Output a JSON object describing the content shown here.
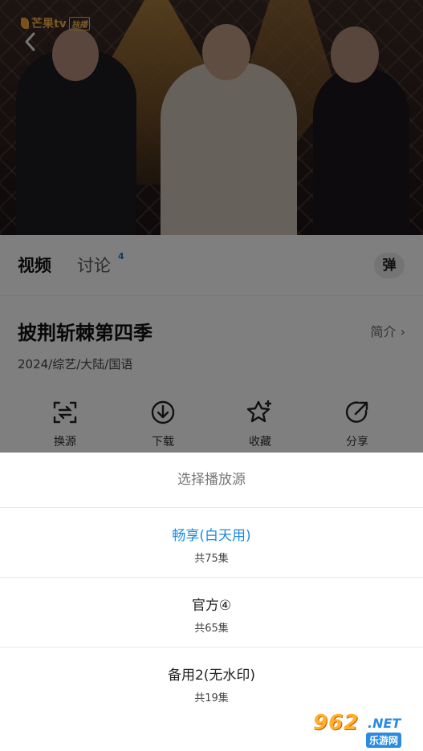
{
  "video": {
    "logo_text": "芒果tv",
    "logo_badge": "独播",
    "back_icon": "chevron-left-icon"
  },
  "tabs": [
    {
      "label": "视频"
    },
    {
      "label": "讨论",
      "count": "4"
    }
  ],
  "danmu_label": "弹",
  "show": {
    "title": "披荆斩棘第四季",
    "intro_label": "简介 ›",
    "meta": "2024/综艺/大陆/国语"
  },
  "actions": [
    {
      "label": "换源",
      "icon": "switch-source-icon"
    },
    {
      "label": "下载",
      "icon": "download-icon"
    },
    {
      "label": "收藏",
      "icon": "star-icon"
    },
    {
      "label": "分享",
      "icon": "share-icon"
    }
  ],
  "sheet": {
    "title": "选择播放源",
    "sources": [
      {
        "name": "畅享(白天用)",
        "episodes": "共75集",
        "selected": true
      },
      {
        "name": "官方④",
        "episodes": "共65集",
        "selected": false
      },
      {
        "name": "备用2(无水印)",
        "episodes": "共19集",
        "selected": false
      }
    ]
  },
  "watermark": {
    "big": "962",
    "net": ".NET",
    "sub": "乐游网"
  },
  "colors": {
    "accent": "#1a8ae3",
    "count_badge": "#1a79d6"
  }
}
